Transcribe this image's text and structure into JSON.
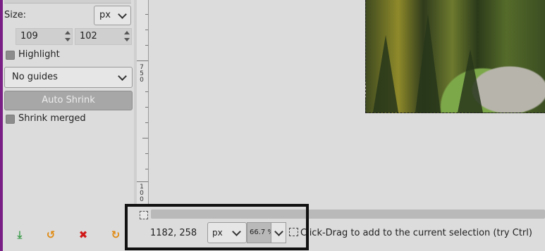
{
  "tool_options": {
    "size_label": "Size:",
    "unit": "px",
    "width_value": "109",
    "height_value": "102",
    "highlight_label": "Highlight",
    "guides_value": "No guides",
    "auto_shrink_label": "Auto Shrink",
    "shrink_merged_label": "Shrink merged"
  },
  "bottom_toolbar": {
    "icons": [
      "save-preset-icon",
      "restore-icon",
      "delete-icon",
      "reset-icon"
    ],
    "colors": [
      "#3c9a4a",
      "#e08a12",
      "#d01818",
      "#e08a12"
    ]
  },
  "ruler": {
    "labels": [
      "750",
      "100"
    ]
  },
  "status_bar": {
    "coords": "1182, 258",
    "unit": "px",
    "zoom": "66.7 %",
    "message": "Click-Drag to add to the current selection (try Ctrl)"
  },
  "colors": {
    "window_edge": "#7a1f86",
    "background": "#dcdcdc",
    "highlight_frame": "#111111"
  }
}
